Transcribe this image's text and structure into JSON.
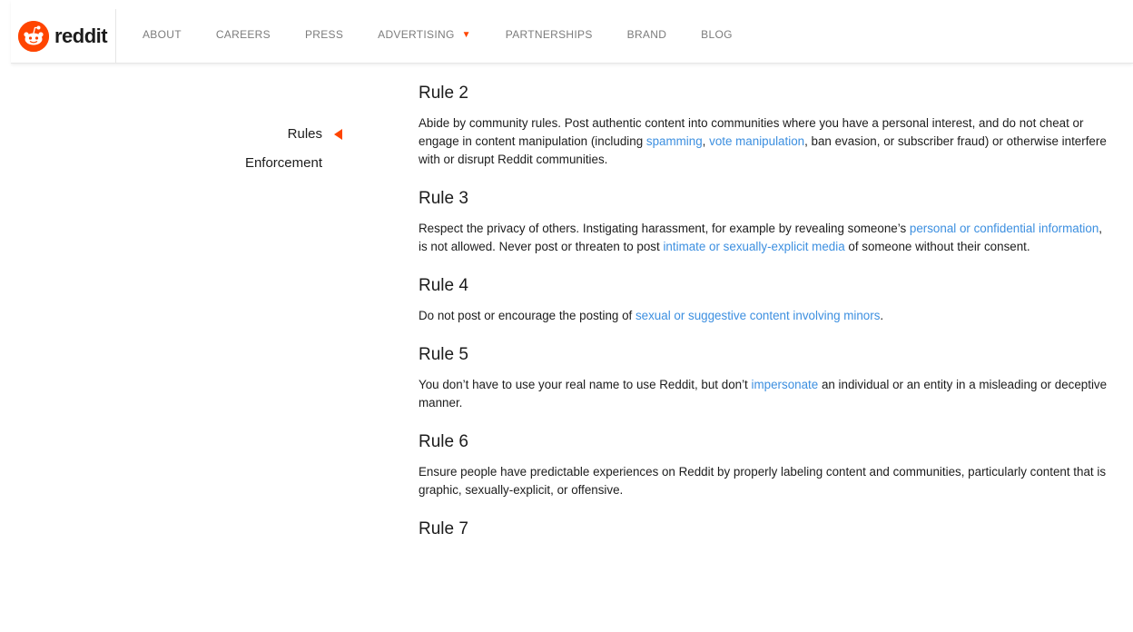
{
  "header": {
    "logo_text": "reddit",
    "nav": [
      "ABOUT",
      "CAREERS",
      "PRESS",
      "ADVERTISING",
      "PARTNERSHIPS",
      "BRAND",
      "BLOG"
    ]
  },
  "sidebar": {
    "rules_label": "Rules",
    "enforcement_label": "Enforcement"
  },
  "rules": [
    {
      "title": "Rule 2",
      "parts": [
        {
          "t": "Abide by community rules. Post authentic content into communities where you have a personal interest, and do not cheat or engage in content manipulation (including "
        },
        {
          "t": "spamming",
          "link": true
        },
        {
          "t": ", "
        },
        {
          "t": "vote manipulation",
          "link": true
        },
        {
          "t": ", ban evasion, or subscriber fraud) or otherwise interfere with or disrupt Reddit communities."
        }
      ]
    },
    {
      "title": "Rule 3",
      "parts": [
        {
          "t": "Respect the privacy of others. Instigating harassment, for example by revealing someone’s "
        },
        {
          "t": "personal or confidential information",
          "link": true
        },
        {
          "t": ", is not allowed. Never post or threaten to post "
        },
        {
          "t": "intimate or sexually-explicit media",
          "link": true
        },
        {
          "t": " of someone without their consent."
        }
      ]
    },
    {
      "title": "Rule 4",
      "parts": [
        {
          "t": "Do not post or encourage the posting of "
        },
        {
          "t": "sexual or suggestive content involving minors",
          "link": true
        },
        {
          "t": "."
        }
      ]
    },
    {
      "title": "Rule 5",
      "parts": [
        {
          "t": "You don’t have to use your real name to use Reddit, but don’t "
        },
        {
          "t": "impersonate",
          "link": true
        },
        {
          "t": " an individual or an entity in a misleading or deceptive manner."
        }
      ]
    },
    {
      "title": "Rule 6",
      "parts": [
        {
          "t": "Ensure people have predictable experiences on Reddit by properly labeling content and communities, particularly content that is graphic, sexually-explicit, or offensive."
        }
      ]
    },
    {
      "title": "Rule 7",
      "parts": []
    }
  ],
  "colors": {
    "brand": "#ff4500",
    "link": "#3c8fe0"
  }
}
